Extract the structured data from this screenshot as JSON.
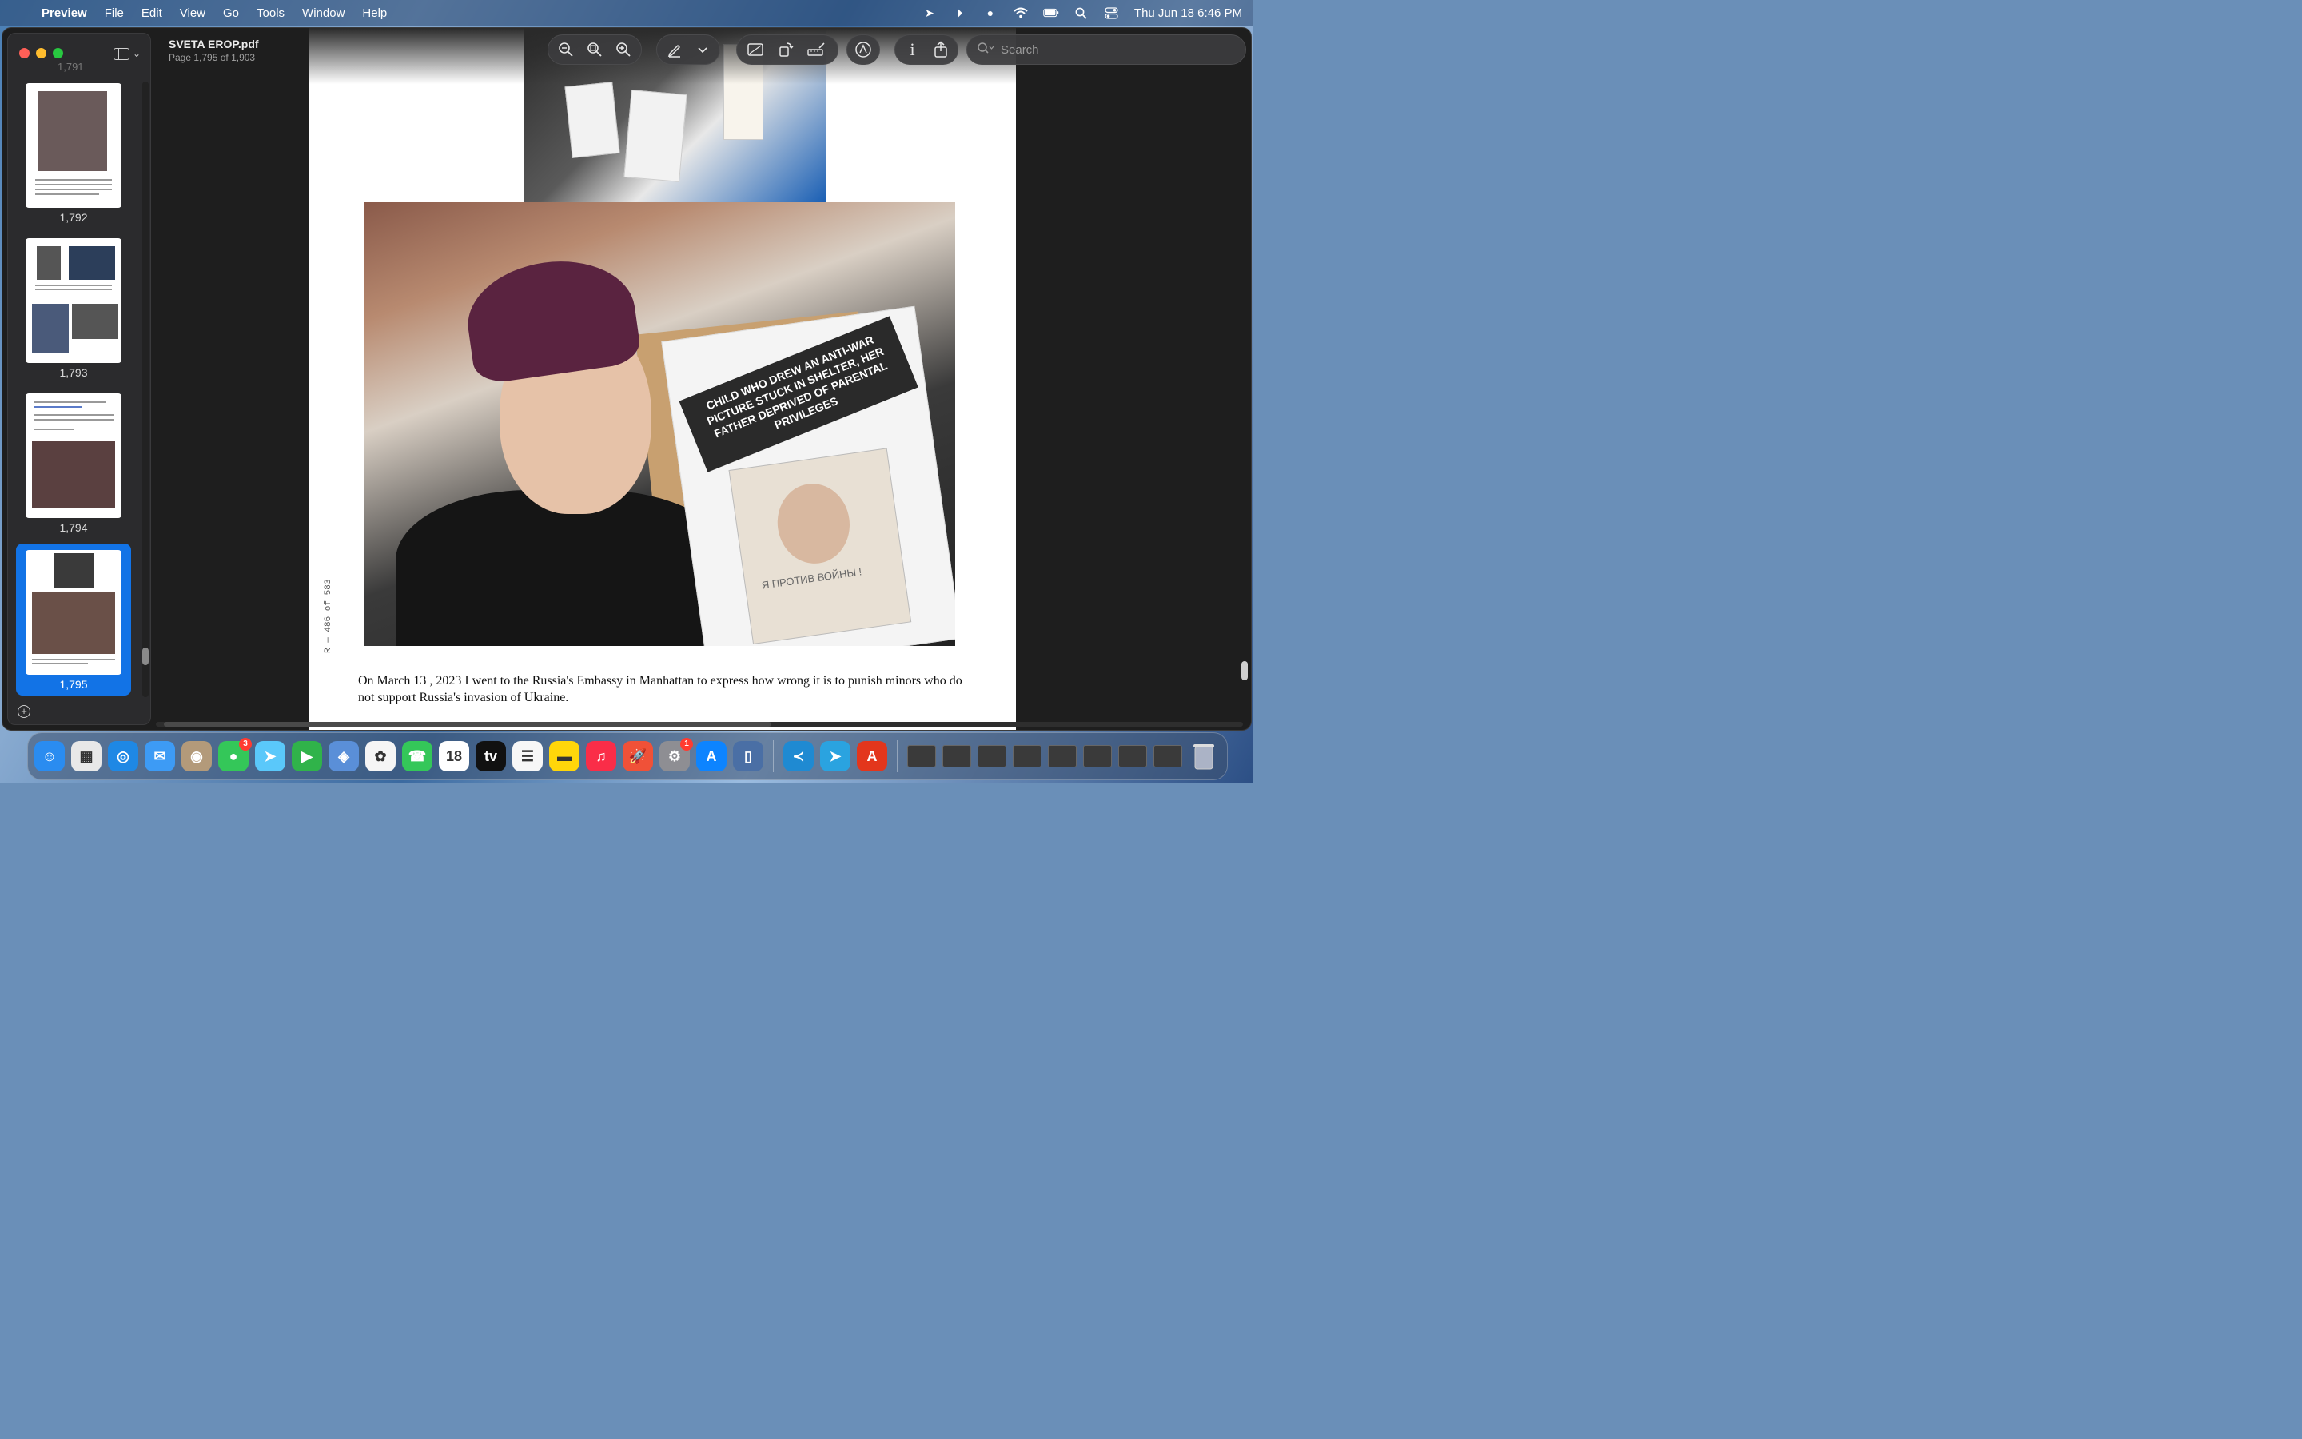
{
  "menubar": {
    "app_name": "Preview",
    "menus": [
      "File",
      "Edit",
      "View",
      "Go",
      "Tools",
      "Window",
      "Help"
    ],
    "clock": "Thu Jun 18  6:46 PM",
    "status_icons": [
      "location-icon",
      "play-circle-icon",
      "user-icon",
      "wifi-icon",
      "battery-icon",
      "search-icon",
      "control-center-icon"
    ]
  },
  "window": {
    "title": "SVETA EROP.pdf",
    "subtitle": "Page 1,795 of 1,903"
  },
  "sidebar": {
    "prev_label": "1,791",
    "thumbnails": [
      {
        "label": "1,792"
      },
      {
        "label": "1,793"
      },
      {
        "label": "1,794"
      },
      {
        "label": "1,795"
      }
    ]
  },
  "toolbar": {
    "search_placeholder": "Search"
  },
  "page": {
    "poster_text": "CHILD WHO DREW AN ANTI-WAR PICTURE STUCK IN SHELTER, HER FATHER DEPRIVED OF PARENTAL PRIVILEGES",
    "drawing_text": "Я ПРОТИВ ВОЙНЫ !",
    "caption": "On March 13 , 2023 I went to the Russia's Embassy in Manhattan to express how wrong it is to punish minors who do not support Russia's invasion of Ukraine.",
    "side_note": "R — 486 of 583"
  },
  "dock": {
    "apps": [
      {
        "name": "Finder",
        "glyph": "☺",
        "color": "#2a8cf0"
      },
      {
        "name": "Launchpad",
        "glyph": "▦",
        "color": "#e8e8e8"
      },
      {
        "name": "Safari",
        "glyph": "◎",
        "color": "#1e88e5"
      },
      {
        "name": "Mail",
        "glyph": "✉",
        "color": "#3d9bf5"
      },
      {
        "name": "Contacts",
        "glyph": "◉",
        "color": "#b39a7a"
      },
      {
        "name": "Messages",
        "glyph": "●",
        "color": "#34c759",
        "badge": "3"
      },
      {
        "name": "Maps",
        "glyph": "➤",
        "color": "#5ac8fa"
      },
      {
        "name": "FaceTime",
        "glyph": "▶",
        "color": "#30b34a"
      },
      {
        "name": "Preview",
        "glyph": "◈",
        "color": "#5a8fd8"
      },
      {
        "name": "Photos",
        "glyph": "✿",
        "color": "#f5f5f5"
      },
      {
        "name": "Phone",
        "glyph": "☎",
        "color": "#34c759"
      },
      {
        "name": "Calendar",
        "glyph": "18",
        "color": "#ffffff"
      },
      {
        "name": "TV",
        "glyph": "tv",
        "color": "#111111"
      },
      {
        "name": "Reminders",
        "glyph": "☰",
        "color": "#f7f7f7"
      },
      {
        "name": "Notes",
        "glyph": "▬",
        "color": "#ffd60a"
      },
      {
        "name": "Music",
        "glyph": "♫",
        "color": "#fa2d48"
      },
      {
        "name": "Rocket",
        "glyph": "🚀",
        "color": "#f05138"
      },
      {
        "name": "System Settings",
        "glyph": "⚙",
        "color": "#8e8e93",
        "badge": "1"
      },
      {
        "name": "App Store",
        "glyph": "A",
        "color": "#0d84ff"
      },
      {
        "name": "Simulator",
        "glyph": "▯",
        "color": "#4a6fa5"
      },
      {
        "name": "VS Code",
        "glyph": "≺",
        "color": "#1f8ad2"
      },
      {
        "name": "Telegram",
        "glyph": "➤",
        "color": "#2aa3e0"
      },
      {
        "name": "Acrobat",
        "glyph": "A",
        "color": "#e3361c"
      }
    ],
    "trash": "Trash"
  }
}
